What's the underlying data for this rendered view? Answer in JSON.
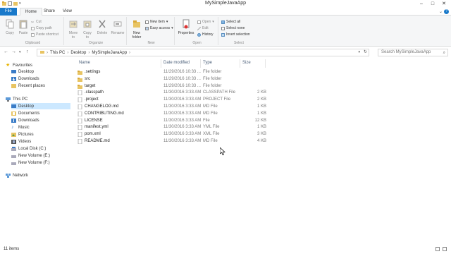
{
  "window": {
    "title": "MySimpleJavaApp"
  },
  "tabs": {
    "file": "File",
    "home": "Home",
    "share": "Share",
    "view": "View"
  },
  "ribbon": {
    "clipboard": {
      "copy": "Copy",
      "paste": "Paste",
      "cut": "Cut",
      "copy_path": "Copy path",
      "paste_shortcut": "Paste shortcut",
      "label": "Clipboard"
    },
    "organize": {
      "move_to": "Move to",
      "copy_to": "Copy to",
      "delete": "Delete",
      "rename": "Rename",
      "label": "Organize"
    },
    "new": {
      "new_folder": "New folder",
      "new_item": "New item",
      "easy_access": "Easy access",
      "label": "New"
    },
    "open": {
      "properties": "Properties",
      "open": "Open",
      "edit": "Edit",
      "history": "History",
      "label": "Open"
    },
    "select": {
      "select_all": "Select all",
      "select_none": "Select none",
      "invert_selection": "Invert selection",
      "label": "Select"
    }
  },
  "address": {
    "crumbs": [
      "This PC",
      "Desktop",
      "MySimpleJavaApp"
    ],
    "search_placeholder": "Search MySimpleJavaApp"
  },
  "nav": {
    "favourites": "Favourites",
    "fav_items": [
      "Desktop",
      "Downloads",
      "Recent places"
    ],
    "this_pc": "This PC",
    "pc_items": [
      "Desktop",
      "Documents",
      "Downloads",
      "Music",
      "Pictures",
      "Videos",
      "Local Disk (C:)",
      "New Volume (E:)",
      "New Volume (F:)"
    ],
    "network": "Network"
  },
  "columns": {
    "name": "Name",
    "date": "Date modified",
    "type": "Type",
    "size": "Size"
  },
  "files": [
    {
      "name": ".settings",
      "date": "11/29/2016 10:33 ...",
      "type": "File folder",
      "size": "",
      "icon": "folder"
    },
    {
      "name": "src",
      "date": "11/29/2016 10:33 ...",
      "type": "File folder",
      "size": "",
      "icon": "folder"
    },
    {
      "name": "target",
      "date": "11/29/2016 10:33 ...",
      "type": "File folder",
      "size": "",
      "icon": "folder"
    },
    {
      "name": ".classpath",
      "date": "11/30/2016 3:33 AM",
      "type": "CLASSPATH File",
      "size": "2 KB",
      "icon": "file"
    },
    {
      "name": ".project",
      "date": "11/30/2016 3:33 AM",
      "type": "PROJECT File",
      "size": "2 KB",
      "icon": "file"
    },
    {
      "name": "CHANGELOG.md",
      "date": "11/30/2016 3:33 AM",
      "type": "MD File",
      "size": "1 KB",
      "icon": "file"
    },
    {
      "name": "CONTRIBUTING.md",
      "date": "11/30/2016 3:33 AM",
      "type": "MD File",
      "size": "1 KB",
      "icon": "file"
    },
    {
      "name": "LICENSE",
      "date": "11/30/2016 3:33 AM",
      "type": "File",
      "size": "12 KB",
      "icon": "file"
    },
    {
      "name": "manifest.yml",
      "date": "11/30/2016 3:33 AM",
      "type": "YML File",
      "size": "1 KB",
      "icon": "file"
    },
    {
      "name": "pom.xml",
      "date": "11/30/2016 3:33 AM",
      "type": "XML File",
      "size": "3 KB",
      "icon": "file"
    },
    {
      "name": "README.md",
      "date": "11/30/2016 3:33 AM",
      "type": "MD File",
      "size": "4 KB",
      "icon": "file"
    }
  ],
  "status": {
    "count": "11 items"
  },
  "colors": {
    "file_tab": "#1979ca",
    "selection": "#cce8ff",
    "folder": "#e8c463"
  }
}
